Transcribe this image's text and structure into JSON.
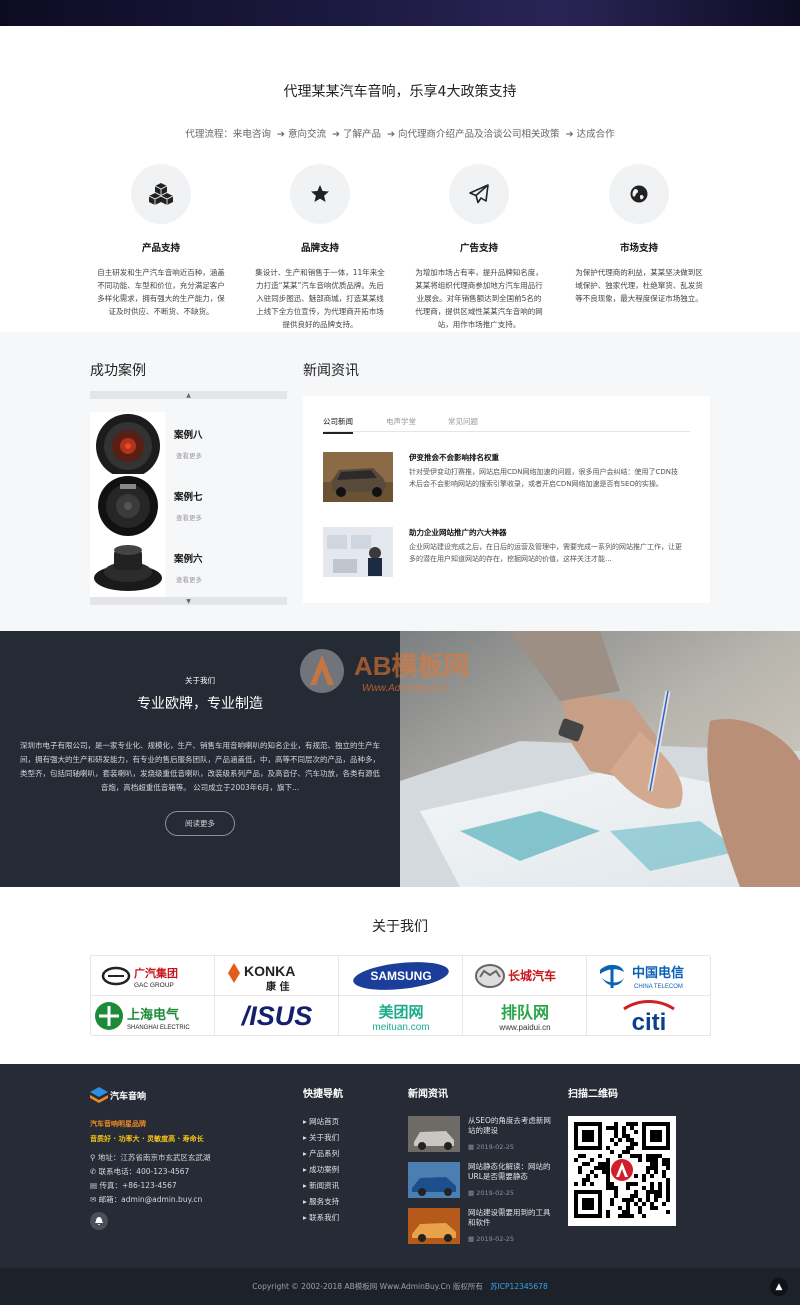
{
  "agency": {
    "title": "代理某某汽车音响，乐享4大政策支持",
    "flow_label": "代理流程：",
    "flow_steps": [
      "来电咨询",
      "意向交流",
      "了解产品",
      "向代理商介绍产品及洽谈公司相关政策",
      "达成合作"
    ],
    "features": [
      {
        "icon": "cubes-icon",
        "title": "产品支持",
        "desc": "自主研发和生产汽车音响近百种，涵盖不同功能、车型和价位，充分满足客户多样化需求，拥有强大的生产能力，保证及时供应、不断货、不缺货。"
      },
      {
        "icon": "star-icon",
        "title": "品牌支持",
        "desc": "集设计、生产和销售于一体，11年来全力打造“某某”汽车音响优质品牌。先后入驻同步图迅、魅部商城，打造某某线上线下全方位宣传，为代理商开拓市场提供良好的品牌支持。"
      },
      {
        "icon": "paper-plane-icon",
        "title": "广告支持",
        "desc": "为增加市场占有率，提升品牌知名度，某某将组织代理商参加地方汽车用品行业展会。对年销售额达到全国前5名的代理商，提供区域性某某汽车音响的网站，用作市场推广支持。"
      },
      {
        "icon": "globe-icon",
        "title": "市场支持",
        "desc": "为保护代理商的利益，某某坚决做到区域保护、独家代理，杜绝窜货、乱发货等不良现象，最大程度保证市场独立。"
      }
    ]
  },
  "cases": {
    "title": "成功案例",
    "items": [
      {
        "name": "案例八",
        "more": "查看更多"
      },
      {
        "name": "案例七",
        "more": "查看更多"
      },
      {
        "name": "案例六",
        "more": "查看更多"
      }
    ]
  },
  "news": {
    "title": "新闻资讯",
    "tabs": [
      "公司新闻",
      "电声学堂",
      "常见问题"
    ],
    "items": [
      {
        "title": "伊变推会不会影响排名权重",
        "desc": "针对受伊变动打赛推，网站启用CDN网络加速的问题，很多用户会纠结：使用了CDN技术后会不会影响网站的搜索引擎收录，或者开启CDN网络加速是否有SEO的实操。"
      },
      {
        "title": "助力企业网站推广的六大神器",
        "desc": "企业网站建设完成之后，在日后的运营及管理中，需要完成一系列的网站推广工作，让更多的潜在用户知道网站的存在，挖掘网站的价值，这样关注才能..."
      }
    ]
  },
  "about": {
    "small_title": "关于我们",
    "title": "专业欧牌，专业制造",
    "desc": "深圳市电子有限公司，是一家专业化、规模化，生产、销售车用音响喇叭的知名企业，有规范、独立的生产车间，拥有强大的生产和研发能力，有专业的售后服务团队，产品涵盖低，中，高等不同层次的产品，品种多，类型齐，包括同轴喇叭，套装喇叭，发烧级重低音喇叭，改装级系列产品，及高音仔、汽车功放，各类有源低音炮，高档超重低音箱等。 公司成立于2003年6月，旗下...",
    "button": "阅读更多",
    "watermark_main": "AB模板网",
    "watermark_sub": "Www.AdminBuy.Cn"
  },
  "partners": {
    "title": "关于我们",
    "logos": [
      {
        "name": "gac-logo",
        "line1": "广汽集团",
        "line2": "GAC GROUP"
      },
      {
        "name": "konka-logo",
        "line1": "KONKA",
        "line2": "康 佳"
      },
      {
        "name": "samsung-logo",
        "line1": "SAMSUNG",
        "line2": ""
      },
      {
        "name": "greatwall-logo",
        "line1": "长城汽车",
        "line2": ""
      },
      {
        "name": "chinatelecom-logo",
        "line1": "中国电信",
        "line2": "CHINA TELECOM"
      },
      {
        "name": "shanghai-electric-logo",
        "line1": "上海电气",
        "line2": "SHANGHAI ELECTRIC"
      },
      {
        "name": "asus-logo",
        "line1": "/ISUS",
        "line2": ""
      },
      {
        "name": "meituan-logo",
        "line1": "美团网",
        "line2": "meituan.com"
      },
      {
        "name": "paidui-logo",
        "line1": "排队网",
        "line2": "www.paidui.cn"
      },
      {
        "name": "citi-logo",
        "line1": "citi",
        "line2": ""
      }
    ]
  },
  "footer": {
    "brand": "汽车音响",
    "slogan1": "汽车音响明星品牌",
    "slogan2": "音质好 · 功率大 · 灵敏度高 · 寿命长",
    "address": "地址：江苏省南京市玄武区玄武湖",
    "phone": "联系电话：400-123-4567",
    "fax": "传真：+86-123-4567",
    "email": "邮箱：admin@admin.buy.cn",
    "nav_title": "快捷导航",
    "nav": [
      "网站首页",
      "关于我们",
      "产品系列",
      "成功案例",
      "新闻资讯",
      "服务支持",
      "联系我们"
    ],
    "news_title": "新闻资讯",
    "news": [
      {
        "title": "从SEO的角度去考虑新网站的建设",
        "date": "2019-02-25"
      },
      {
        "title": "网站静态化解读：网站的URL是否需要静态",
        "date": "2019-02-25"
      },
      {
        "title": "网站建设需要用到的工具和软件",
        "date": "2019-02-25"
      }
    ],
    "qr_title": "扫描二维码",
    "copyright": "Copyright © 2002-2018 AB模板网 Www.AdminBuy.Cn 版权所有",
    "icp": "苏ICP12345678"
  },
  "colors": {
    "accent_orange": "#f08a24",
    "icp_blue": "#3aa3e3",
    "dark_bg": "#262b35"
  }
}
